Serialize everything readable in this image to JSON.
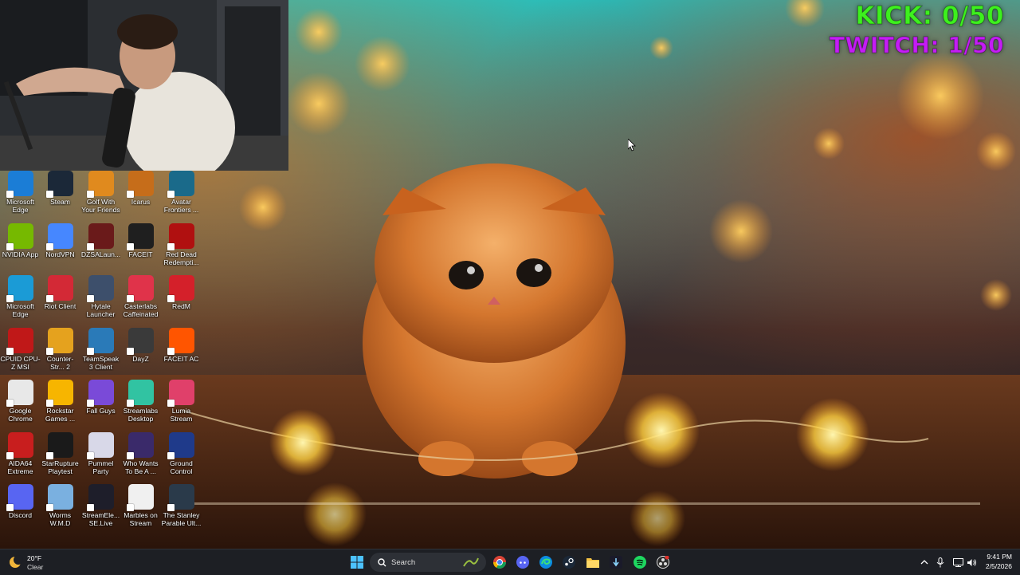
{
  "overlay": {
    "kick_counter": "KICK: 0/50",
    "twitch_counter": "TWITCH: 1/50"
  },
  "desktop_icons": [
    {
      "label": "Microsoft Edge",
      "color": "#1b7dd6",
      "icon": "edge-icon"
    },
    {
      "label": "Steam",
      "color": "#1b2838",
      "icon": "steam-icon"
    },
    {
      "label": "Golf With Your Friends",
      "color": "#e08a1e",
      "icon": "golf-icon"
    },
    {
      "label": "Icarus",
      "color": "#c66d1a",
      "icon": "icarus-icon"
    },
    {
      "label": "Avatar Frontiers ...",
      "color": "#1a6a8a",
      "icon": "avatar-icon"
    },
    {
      "label": "NVIDIA App",
      "color": "#76b900",
      "icon": "nvidia-icon"
    },
    {
      "label": "NordVPN",
      "color": "#4687ff",
      "icon": "nordvpn-icon"
    },
    {
      "label": "DZSALaun...",
      "color": "#6a1a1a",
      "icon": "dzsa-icon"
    },
    {
      "label": "FACEIT",
      "color": "#1f1f1f",
      "icon": "faceit-icon"
    },
    {
      "label": "Red Dead Redempti...",
      "color": "#b01010",
      "icon": "rdr-icon"
    },
    {
      "label": "Microsoft Edge",
      "color": "#1b9bd6",
      "icon": "edge-icon"
    },
    {
      "label": "Riot Client",
      "color": "#d32936",
      "icon": "riot-icon"
    },
    {
      "label": "Hytale Launcher",
      "color": "#3d4f6b",
      "icon": "hytale-icon"
    },
    {
      "label": "Casterlabs Caffeinated",
      "color": "#e0334a",
      "icon": "casterlabs-icon"
    },
    {
      "label": "RedM",
      "color": "#d4202a",
      "icon": "redm-icon"
    },
    {
      "label": "CPUID CPU-Z MSI",
      "color": "#c01818",
      "icon": "cpuz-icon"
    },
    {
      "label": "Counter-Str... 2",
      "color": "#e5a21e",
      "icon": "cs2-icon"
    },
    {
      "label": "TeamSpeak 3 Client",
      "color": "#2a7ab8",
      "icon": "teamspeak-icon"
    },
    {
      "label": "DayZ",
      "color": "#3a3a3a",
      "icon": "dayz-icon"
    },
    {
      "label": "FACEIT AC",
      "color": "#ff5500",
      "icon": "faceit-ac-icon"
    },
    {
      "label": "Google Chrome",
      "color": "#e8e8e8",
      "icon": "chrome-icon"
    },
    {
      "label": "Rockstar Games ...",
      "color": "#f7b500",
      "icon": "rockstar-icon"
    },
    {
      "label": "Fall Guys",
      "color": "#7a4ad8",
      "icon": "fallguys-icon"
    },
    {
      "label": "Streamlabs Desktop",
      "color": "#31c3a2",
      "icon": "streamlabs-icon"
    },
    {
      "label": "Lumia Stream",
      "color": "#e0406a",
      "icon": "lumia-icon"
    },
    {
      "label": "AIDA64 Extreme",
      "color": "#c81e1e",
      "icon": "aida64-icon"
    },
    {
      "label": "StarRupture Playtest",
      "color": "#1a1a1a",
      "icon": "starrupture-icon"
    },
    {
      "label": "Pummel Party",
      "color": "#d8d8e8",
      "icon": "pummel-icon"
    },
    {
      "label": "Who Wants To Be A ...",
      "color": "#3a2a6a",
      "icon": "millionaire-icon"
    },
    {
      "label": "Ground Control",
      "color": "#1f3a8a",
      "icon": "groundcontrol-icon"
    },
    {
      "label": "Discord",
      "color": "#5865f2",
      "icon": "discord-icon"
    },
    {
      "label": "Worms W.M.D",
      "color": "#7ab0e0",
      "icon": "worms-icon"
    },
    {
      "label": "StreamEle... SE.Live",
      "color": "#1e1e2a",
      "icon": "streamelements-icon"
    },
    {
      "label": "Marbles on Stream",
      "color": "#f0f0f0",
      "icon": "marbles-icon"
    },
    {
      "label": "The Stanley Parable Ult...",
      "color": "#2a3a4a",
      "icon": "stanley-icon"
    }
  ],
  "taskbar": {
    "weather_temp": "20°F",
    "weather_cond": "Clear",
    "search_placeholder": "Search",
    "time": "9:41 PM",
    "date": "2/5/2026"
  }
}
